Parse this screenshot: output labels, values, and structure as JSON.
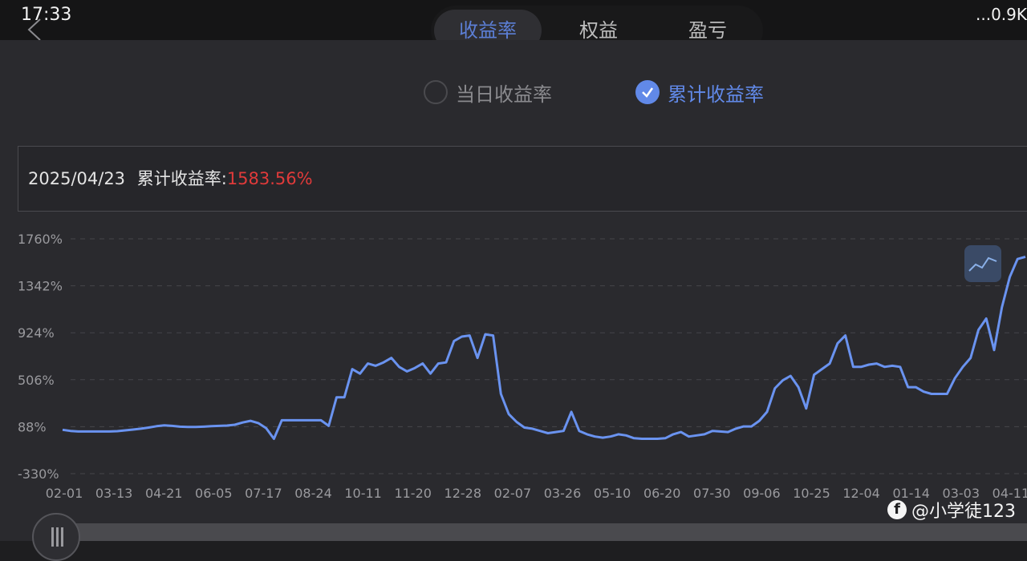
{
  "status": {
    "time": "17:33",
    "right": "...0.9K"
  },
  "tabs": [
    {
      "label": "收益率"
    },
    {
      "label": "权益"
    },
    {
      "label": "盈亏"
    }
  ],
  "radios": {
    "daily": "当日收益率",
    "cumulative": "累计收益率"
  },
  "info": {
    "date": "2025/04/23",
    "label": "累计收益率:",
    "value": "1583.56%"
  },
  "watermark": "@小学徒123",
  "colors": {
    "accent": "#6189e8",
    "positive": "#e03a3a",
    "line": "#6a93f0"
  },
  "chart_data": {
    "type": "line",
    "yticks": [
      "1760%",
      "1342%",
      "924%",
      "506%",
      "88%",
      "-330%"
    ],
    "ylim": [
      -330,
      1760
    ],
    "xticks": [
      "02-01",
      "03-13",
      "04-21",
      "06-05",
      "07-17",
      "08-24",
      "10-11",
      "11-20",
      "12-28",
      "02-07",
      "03-26",
      "05-10",
      "06-20",
      "07-30",
      "09-06",
      "10-25",
      "12-04",
      "01-14",
      "03-03",
      "04-11"
    ],
    "series": [
      {
        "values": [
          60,
          50,
          45,
          45,
          45,
          45,
          45,
          48,
          55,
          62,
          70,
          80,
          92,
          100,
          95,
          88,
          85,
          85,
          88,
          92,
          95,
          98,
          105,
          125,
          140,
          120,
          75,
          -20,
          145,
          145,
          145,
          145,
          145,
          145,
          95,
          350,
          350,
          600,
          560,
          650,
          630,
          660,
          700,
          620,
          580,
          610,
          650,
          560,
          650,
          660,
          850,
          890,
          900,
          700,
          910,
          900,
          380,
          200,
          130,
          80,
          70,
          50,
          30,
          40,
          50,
          220,
          50,
          20,
          0,
          -10,
          0,
          20,
          10,
          -15,
          -20,
          -20,
          -20,
          -15,
          20,
          40,
          0,
          10,
          20,
          50,
          45,
          40,
          70,
          90,
          90,
          140,
          220,
          430,
          500,
          540,
          440,
          250,
          550,
          600,
          650,
          830,
          900,
          620,
          620,
          640,
          650,
          620,
          630,
          620,
          440,
          440,
          400,
          380,
          380,
          380,
          520,
          620,
          700,
          950,
          1050,
          770,
          1150,
          1420,
          1580,
          1600
        ]
      }
    ]
  }
}
